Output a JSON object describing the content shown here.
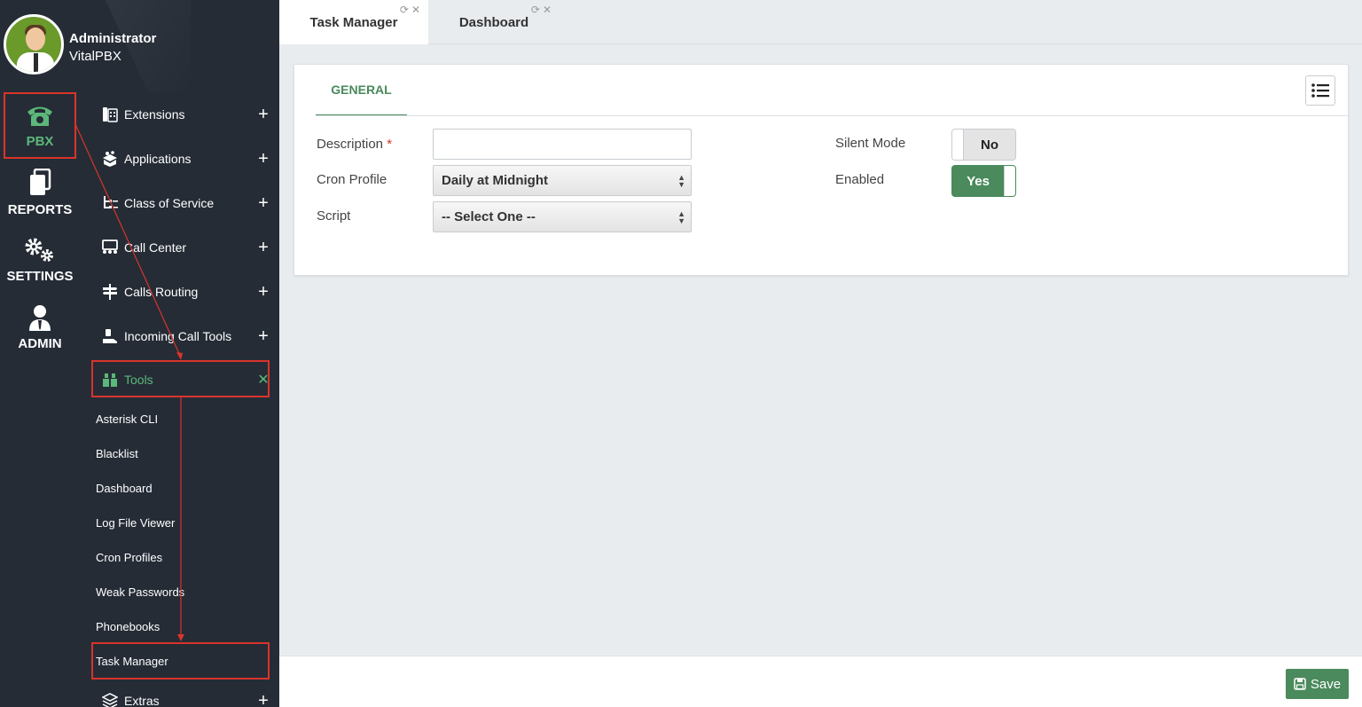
{
  "user": {
    "name": "Administrator",
    "org": "VitalPBX"
  },
  "rail": {
    "pbx": "PBX",
    "reports": "REPORTS",
    "settings": "SETTINGS",
    "admin": "ADMIN"
  },
  "menu": {
    "items": [
      {
        "label": "Extensions",
        "icon": "extensions-icon"
      },
      {
        "label": "Applications",
        "icon": "applications-icon"
      },
      {
        "label": "Class of Service",
        "icon": "class-of-service-icon"
      },
      {
        "label": "Call Center",
        "icon": "call-center-icon"
      },
      {
        "label": "Calls Routing",
        "icon": "calls-routing-icon"
      },
      {
        "label": "Incoming Call Tools",
        "icon": "incoming-call-tools-icon"
      }
    ],
    "tools": "Tools",
    "tools_sub": [
      "Asterisk CLI",
      "Blacklist",
      "Dashboard",
      "Log File Viewer",
      "Cron Profiles",
      "Weak Passwords",
      "Phonebooks",
      "Task Manager"
    ],
    "extras": "Extras"
  },
  "tabs": [
    {
      "label": "Task Manager",
      "active": true
    },
    {
      "label": "Dashboard",
      "active": false
    }
  ],
  "panel": {
    "tab": "GENERAL",
    "description_label": "Description",
    "description_value": "",
    "cron_label": "Cron Profile",
    "cron_value": "Daily at Midnight",
    "script_label": "Script",
    "script_value": "-- Select One --",
    "silent_label": "Silent Mode",
    "silent_value": "No",
    "enabled_label": "Enabled",
    "enabled_value": "Yes"
  },
  "footer": {
    "save": "Save"
  },
  "colors": {
    "accent": "#4a8a5c",
    "sidebar": "#252c36",
    "highlight": "#d9342b",
    "menu_active": "#5cb87a"
  }
}
